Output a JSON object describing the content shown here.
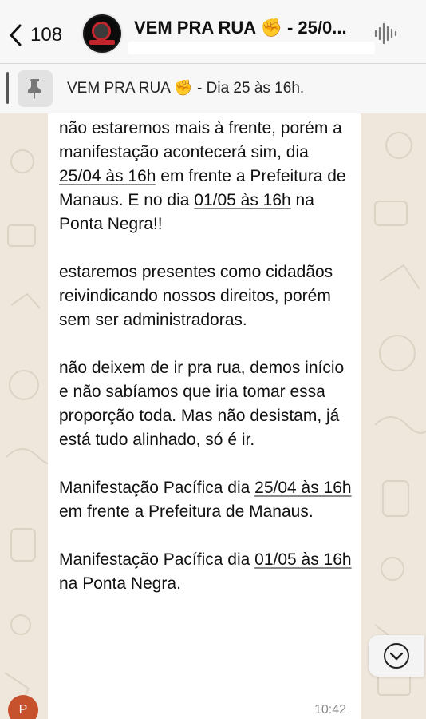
{
  "header": {
    "back_count": "108",
    "title": "VEM PRA RUA ✊ - 25/0..."
  },
  "pinned": {
    "text": "VEM PRA RUA ✊ - Dia 25 às 16h."
  },
  "message": {
    "p1_before": "não estaremos mais à frente, porém a manifestação acontecerá sim, dia ",
    "p1_date1": "25/04 às 16h",
    "p1_mid": " em frente a Prefeitura de Manaus. E no dia ",
    "p1_date2": "01/05 às 16h",
    "p1_after": " na Ponta Negra!!",
    "p2": "estaremos presentes como cidadãos reivindicando nossos direitos, porém sem ser administradoras.",
    "p3": "não deixem de ir pra rua, demos início e não sabíamos que iria tomar essa proporção toda. Mas não desistam, já está tudo alinhado, só é ir.",
    "p4_before": "Manifestação Pacífica dia ",
    "p4_date": "25/04 às 16h",
    "p4_after": " em frente a Prefeitura de Manaus.",
    "p5_before": "Manifestação Pacífica dia ",
    "p5_date": "01/05 às 16h",
    "p5_after": " na Ponta Negra.",
    "time": "10:42"
  },
  "participant_initial": "P",
  "colors": {
    "wallpaper": "#efe7dc",
    "bubble": "#ffffff",
    "header": "#f7f7f7",
    "participant_avatar": "#c6512d"
  },
  "icons": {
    "back": "chevron-left-icon",
    "audio": "audio-wave-icon",
    "pin": "pin-icon",
    "scroll": "chevron-down-circle-icon"
  }
}
